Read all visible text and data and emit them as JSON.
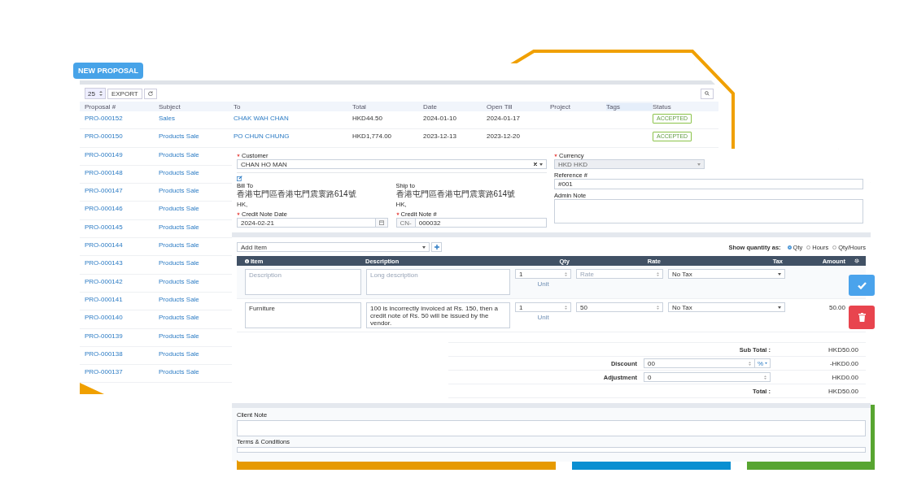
{
  "badge": "NEW PROPOSAL",
  "proposals": {
    "page_size": "25",
    "export": "EXPORT",
    "columns": [
      "Proposal #",
      "Subject",
      "To",
      "Total",
      "Date",
      "Open Till",
      "Project",
      "Tags",
      "Status"
    ],
    "rows": [
      {
        "number": "PRO-000152",
        "subject": "Sales",
        "to": "CHAK WAH CHAN",
        "total": "HKD44.50",
        "date": "2024-01-10",
        "open_till": "2024-01-17",
        "status": "ACCEPTED"
      },
      {
        "number": "PRO-000150",
        "subject": "Products Sale",
        "to": "PO CHUN CHUNG",
        "total": "HKD1,774.00",
        "date": "2023-12-13",
        "open_till": "2023-12-20",
        "status": "ACCEPTED"
      },
      {
        "number": "PRO-000149",
        "subject": "Products Sale"
      },
      {
        "number": "PRO-000148",
        "subject": "Products Sale"
      },
      {
        "number": "PRO-000147",
        "subject": "Products Sale"
      },
      {
        "number": "PRO-000146",
        "subject": "Products Sale"
      },
      {
        "number": "PRO-000145",
        "subject": "Products Sale"
      },
      {
        "number": "PRO-000144",
        "subject": "Products Sale"
      },
      {
        "number": "PRO-000143",
        "subject": "Products Sale"
      },
      {
        "number": "PRO-000142",
        "subject": "Products Sale"
      },
      {
        "number": "PRO-000141",
        "subject": "Products Sale"
      },
      {
        "number": "PRO-000140",
        "subject": "Products Sale"
      },
      {
        "number": "PRO-000139",
        "subject": "Products Sale"
      },
      {
        "number": "PRO-000138",
        "subject": "Products Sale"
      },
      {
        "number": "PRO-000137",
        "subject": "Products Sale"
      }
    ]
  },
  "form": {
    "customer": {
      "label": "Customer",
      "required": true,
      "value": "CHAN HO MAN"
    },
    "bill_to": {
      "label": "Bill To",
      "lines": [
        "香港屯門區香港屯門震寰路614號",
        "HK,"
      ]
    },
    "ship_to": {
      "label": "Ship to",
      "lines": [
        "香港屯門區香港屯門震寰路614號",
        "HK,"
      ]
    },
    "date": {
      "label": "Credit Note Date",
      "required": true,
      "value": "2024-02-21"
    },
    "number": {
      "label": "Credit Note #",
      "required": true,
      "prefix": "CN-",
      "value": "000032"
    },
    "currency": {
      "label": "Currency",
      "required": true,
      "value": "HKD HKD",
      "disabled": true
    },
    "reference": {
      "label": "Reference #",
      "value": "#001"
    },
    "admin_note": {
      "label": "Admin Note"
    }
  },
  "items": {
    "add_item": "Add Item",
    "show_quantity_label": "Show quantity as:",
    "quantity_options": [
      {
        "label": "Qty",
        "selected": true
      },
      {
        "label": "Hours",
        "selected": false
      },
      {
        "label": "Qty/Hours",
        "selected": false
      }
    ],
    "columns": [
      "Item",
      "Description",
      "Qty",
      "Rate",
      "Tax",
      "Amount"
    ],
    "rows": [
      {
        "item_placeholder": "Description",
        "description_placeholder": "Long description",
        "qty": "1",
        "unit": "Unit",
        "rate_placeholder": "Rate",
        "tax": "No Tax"
      },
      {
        "item": "Furniture",
        "description": "100 is incorrectly invoiced at Rs. 150, then a credit note of Rs. 50 will be issued by the vendor.",
        "qty": "1",
        "unit": "Unit",
        "rate": "50",
        "tax": "No Tax",
        "amount": "50.00"
      }
    ]
  },
  "totals": [
    {
      "kind": "plain",
      "label": "Sub Total :",
      "value": "HKD50.00"
    },
    {
      "kind": "discount",
      "label": "Discount",
      "input": "00",
      "unit": "%",
      "value": "-HKD0.00"
    },
    {
      "kind": "input",
      "label": "Adjustment",
      "input": "0",
      "value": "HKD0.00"
    },
    {
      "kind": "plain",
      "label": "Total :",
      "value": "HKD50.00"
    }
  ],
  "notes": {
    "client_note": "Client Note",
    "terms": "Terms & Conditions"
  }
}
